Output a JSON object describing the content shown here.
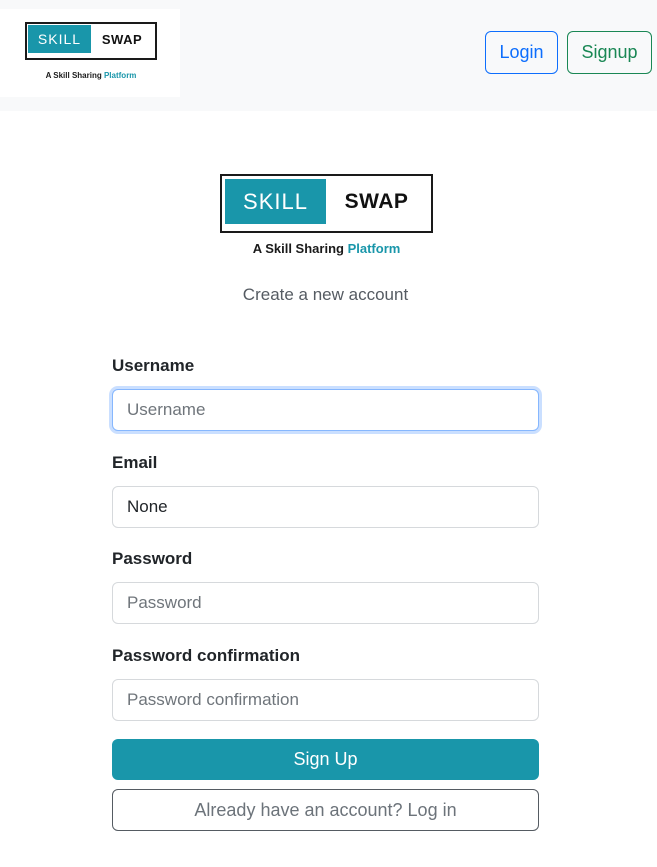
{
  "navbar": {
    "logo": {
      "skill": "SKILL",
      "swap": "SWAP",
      "tagline_prefix": "A Skill Sharing",
      "tagline_accent": "Platform"
    },
    "login_label": "Login",
    "signup_label": "Signup"
  },
  "main": {
    "logo": {
      "skill": "SKILL",
      "swap": "SWAP",
      "tagline_prefix": "A Skill Sharing",
      "tagline_accent": "Platform"
    },
    "subtitle": "Create a new account",
    "form": {
      "username": {
        "label": "Username",
        "placeholder": "Username",
        "value": ""
      },
      "email": {
        "label": "Email",
        "placeholder": "",
        "value": "None"
      },
      "password": {
        "label": "Password",
        "placeholder": "Password",
        "value": ""
      },
      "password_confirmation": {
        "label": "Password confirmation",
        "placeholder": "Password confirmation",
        "value": ""
      },
      "submit_label": "Sign Up",
      "login_link_label": "Already have an account? Log in"
    }
  },
  "colors": {
    "brand": "#1996aa",
    "navbar_bg": "#f8f9fa",
    "login_outline": "#0d6efd",
    "signup_outline": "#198754",
    "secondary_outline": "#555b62"
  }
}
